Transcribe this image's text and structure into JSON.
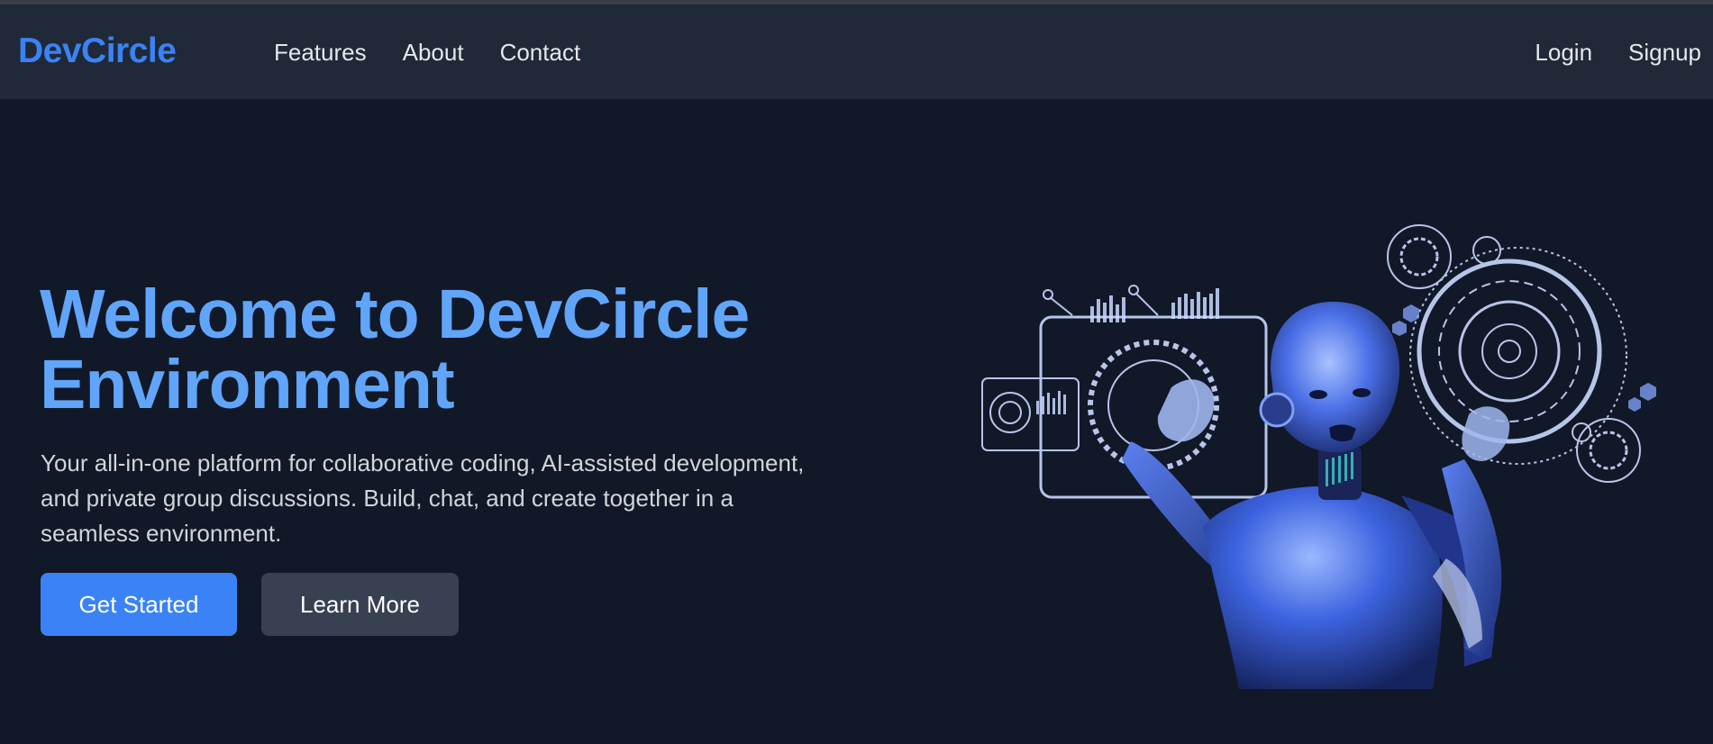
{
  "navbar": {
    "brand": "DevCircle",
    "links": [
      "Features",
      "About",
      "Contact"
    ],
    "login": "Login",
    "signup": "Signup"
  },
  "hero": {
    "title_line1": "Welcome to DevCircle",
    "title_line2": "Environment",
    "description": "Your all-in-one platform for collaborative coding, AI-assisted development, and private group discussions. Build, chat, and create together in a seamless environment.",
    "primary_button": "Get Started",
    "secondary_button": "Learn More"
  },
  "colors": {
    "background": "#111827",
    "navbar": "#1f2937",
    "brand": "#3b82f6",
    "title": "#60a5fa",
    "primary_button": "#3b82f6",
    "secondary_button": "#374151"
  },
  "illustration": {
    "subject": "robot-with-holographic-interfaces"
  }
}
